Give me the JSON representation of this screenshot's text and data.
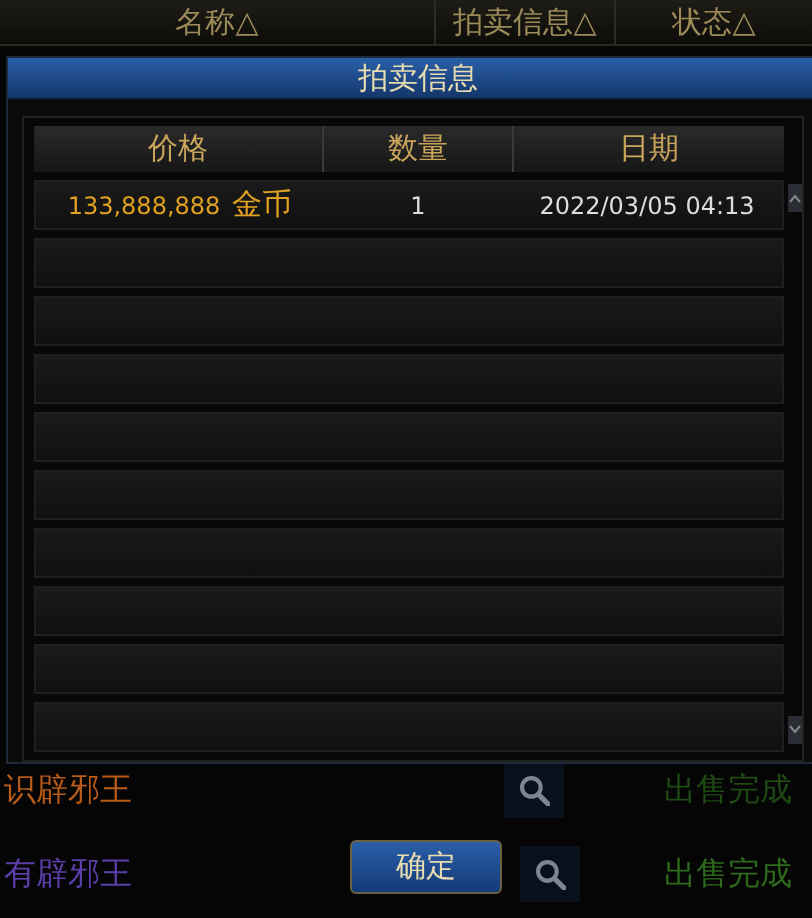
{
  "background_list": {
    "columns": [
      "名称△",
      "拍卖信息△",
      "状态△"
    ],
    "rows": [
      {
        "name": "识辟邪王",
        "color": "#b85a18",
        "status": "出售完成"
      },
      {
        "name": "有辟邪王",
        "color": "#5a3fa8",
        "status": "出售完成"
      }
    ]
  },
  "dialog": {
    "title": "拍卖信息",
    "columns": [
      "价格",
      "数量",
      "日期"
    ],
    "rows": [
      {
        "price": "133,888,888",
        "currency": "金币",
        "quantity": "1",
        "date": "2022/03/05 04:13"
      }
    ]
  },
  "confirm_button": "确定"
}
